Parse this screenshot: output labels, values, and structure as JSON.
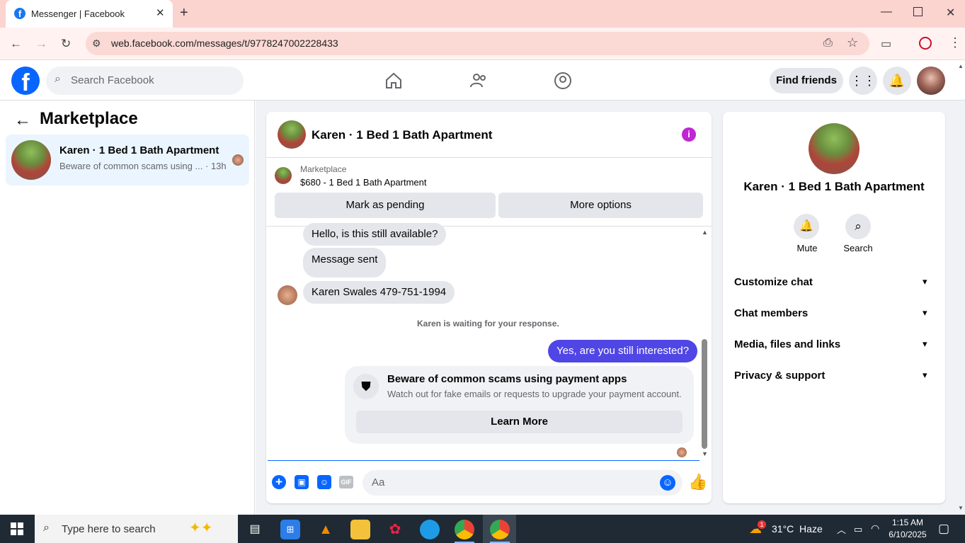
{
  "browser": {
    "tab_title": "Messenger | Facebook",
    "url": "web.facebook.com/messages/t/9778247002228433"
  },
  "fb_header": {
    "search_placeholder": "Search Facebook",
    "find_friends": "Find friends"
  },
  "left_panel": {
    "title": "Marketplace",
    "conversation": {
      "name": "Karen · 1 Bed 1 Bath Apartment",
      "preview": "Beware of common scams using ...",
      "time": "· 13h"
    }
  },
  "chat": {
    "header_name": "Karen · 1 Bed 1 Bath Apartment",
    "listing_label": "Marketplace",
    "listing_title": "$680 - 1 Bed 1 Bath Apartment",
    "mark_pending": "Mark as pending",
    "more_options": "More options",
    "messages": [
      {
        "text": "Hello, is this still available?",
        "from": "other"
      },
      {
        "text": "Message sent",
        "from": "other"
      },
      {
        "text": "Karen Swales 479-751-1994",
        "from": "other"
      }
    ],
    "waiting_notice": "Karen is waiting for your response.",
    "my_message": "Yes, are you still interested?",
    "warning_title": "Beware of common scams using payment apps",
    "warning_body": "Watch out for fake emails or requests to upgrade your payment account.",
    "learn_more": "Learn More",
    "composer_placeholder": "Aa",
    "gif_label": "GIF"
  },
  "info_panel": {
    "name": "Karen · 1 Bed 1 Bath Apartment",
    "mute": "Mute",
    "search": "Search",
    "sections": [
      "Customize chat",
      "Chat members",
      "Media, files and links",
      "Privacy & support"
    ]
  },
  "taskbar": {
    "search_placeholder": "Type here to search",
    "weather": "31°C  Haze",
    "time": "1:15 AM",
    "date": "6/10/2025",
    "weather_badge": "1"
  },
  "colors": {
    "accent": "#0866ff",
    "my_bubble": "#4f46e5",
    "info_icon": "#c026d3"
  }
}
